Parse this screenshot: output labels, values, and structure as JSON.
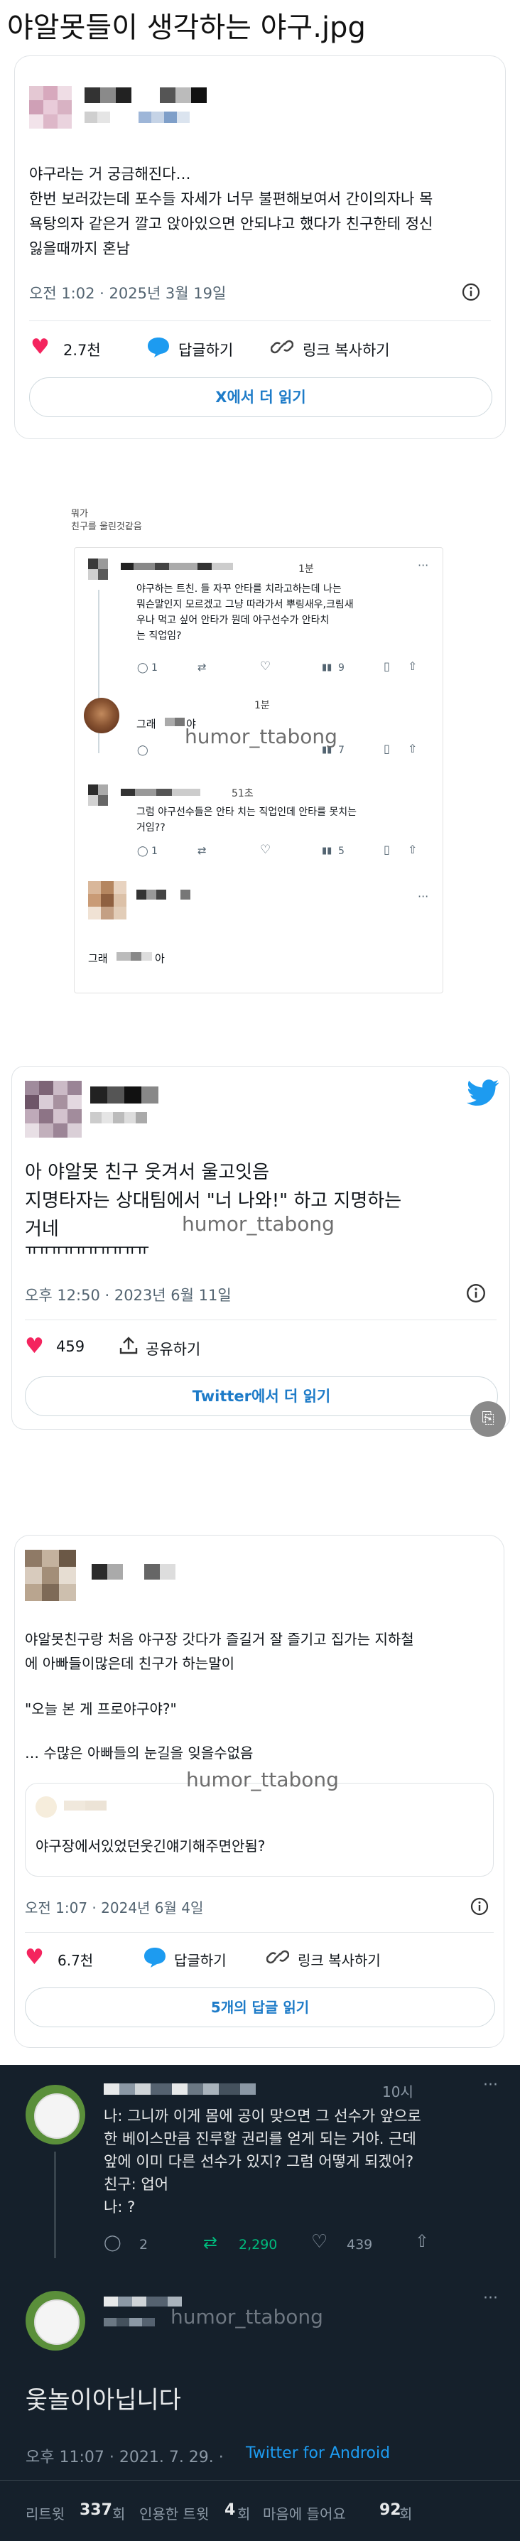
{
  "page_title": "야알못들이 생각하는 야구.jpg",
  "watermark": "humor_ttabong",
  "card1": {
    "body_line1": "야구라는 거 궁금해진다…",
    "body_line2": "한번 보러갔는데 포수들 자세가 너무 불편해보여서 간이의자나 목",
    "body_line3": "욕탕의자 같은거 깔고 앉아있으면 안되냐고 했다가 친구한테 정신",
    "body_line4": "잃을때까지 혼남",
    "timestamp": "오전 1:02 · 2025년 3월 19일",
    "likes": "2.7천",
    "reply": "답글하기",
    "copy_link": "링크 복사하기",
    "read_more": "X에서 더 읽기",
    "info_icon": "info-icon"
  },
  "thread2": {
    "header_line1": "뭐가",
    "header_line2": "친구를 울린것같음",
    "t1_time": "1분",
    "t1_line1": "야구하는 트친.    들 자꾸 안타를 치라고하는데 나는",
    "t1_line2": "뭐슨말인지 모르겠고 그냥 따라가서 뿌링새우,크림새",
    "t1_line3": "우나 먹고 싶어 안타가 뭔데         야구선수가 안타치",
    "t1_line4": "는 직업임?",
    "t1_replies": "1",
    "t1_views": "9",
    "t2_time": "1분",
    "t2_text": "그래",
    "t2_text_suffix": "야",
    "t2_views": "7",
    "t3_time": "51초",
    "t3_line1": "그럼 야구선수들은 안타 치는 직업인데 안타를 못치는",
    "t3_line2": "거임??",
    "t3_replies": "1",
    "t3_views": "5",
    "t4_text": "그래",
    "t4_suffix": "아"
  },
  "card3": {
    "line1": "아 야알못 친구 웃겨서 울고잇음",
    "line2": "지명타자는 상대팀에서 \"너 나와!\" 하고 지명하는",
    "line3": "거네",
    "line4": "ㅠㅠㅠㅠㅠㅠㅠㅠㅠㅠ",
    "timestamp": "오후 12:50 · 2023년 6월 11일",
    "likes": "459",
    "share": "공유하기",
    "read_more": "Twitter에서 더 읽기"
  },
  "card4": {
    "line1": "야알못친구랑 처음 야구장 갓다가 즐길거 잘 즐기고 집가는 지하철",
    "line2": "에 아빠들이많은데 친구가 하는말이",
    "quote": "\"오늘 본 게 프로야구야?\"",
    "line4": "… 수많은 아빠들의 눈길을 잊을수없음",
    "quoted_text": "야구장에서있었던웃긴얘기해주면안됨?",
    "timestamp": "오전 1:07 · 2024년 6월 4일",
    "likes": "6.7천",
    "reply": "답글하기",
    "copy_link": "링크 복사하기",
    "read_more": "5개의 답글 읽기"
  },
  "dark5": {
    "time": "10시",
    "line1": "나: 그니까 이게 몸에 공이 맞으면 그 선수가 앞으로",
    "line2": "한 베이스만큼 진루할 권리를 얻게 되는 거야. 근데",
    "line3": "앞에 이미 다른 선수가 있지? 그럼 어떻게 되겠어?",
    "line4": "친구: 업어",
    "line5": "나: ?",
    "replies": "2",
    "retweets": "2,290",
    "likes": "439",
    "reply_text": "웇놀이아닙니다",
    "timestamp": "오후 11:07 · 2021. 7. 29. · ",
    "client": "Twitter for Android",
    "stats_label1": "리트윗",
    "stats_val1": "337",
    "stats_unit1": "회",
    "stats_label2": "인용한 트윗",
    "stats_val2": "4",
    "stats_unit2": "회",
    "stats_label3": "마음에 들어요",
    "stats_val3": "92",
    "stats_unit3": "회",
    "accent": "#1d9bf0",
    "retweet_color": "#00ba7c",
    "like_color": "#f91880"
  }
}
